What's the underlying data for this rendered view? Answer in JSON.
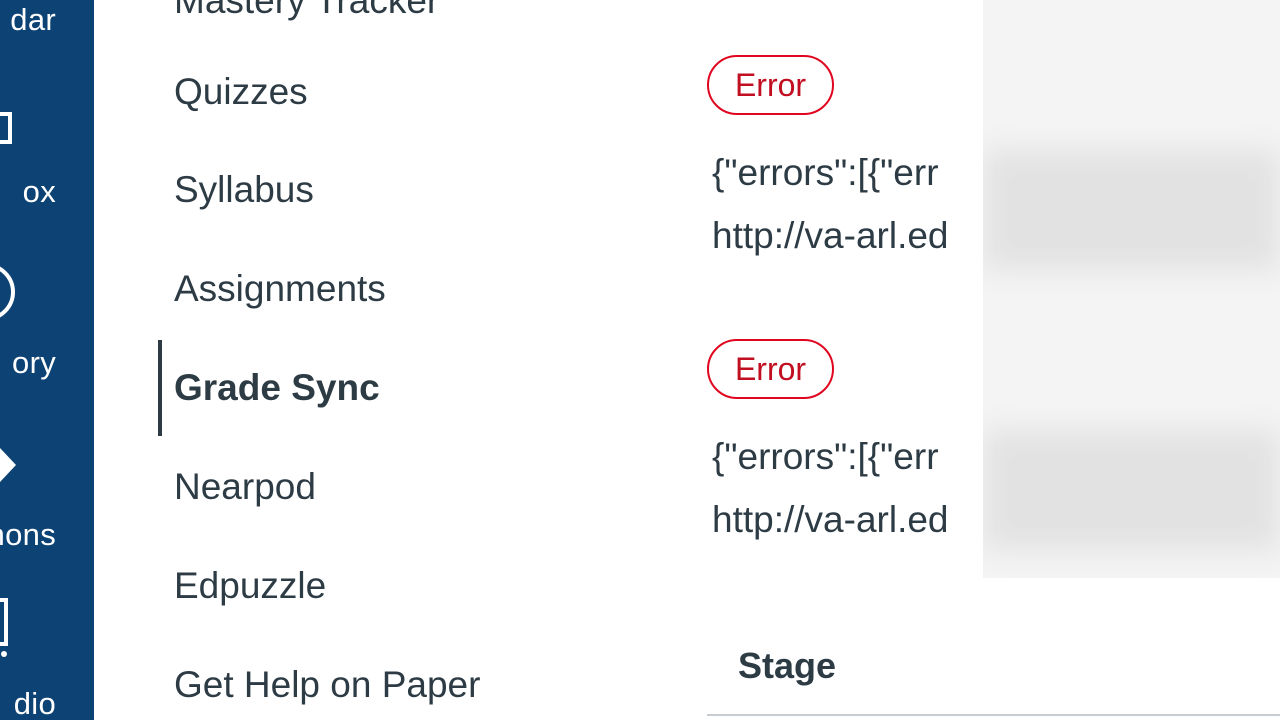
{
  "global_nav": {
    "items": [
      {
        "label": "dar",
        "icon": "calendar-icon"
      },
      {
        "label": "ox",
        "icon": "inbox-icon"
      },
      {
        "label": "ory",
        "icon": "history-icon"
      },
      {
        "label": "mons",
        "icon": "commons-icon"
      },
      {
        "label": "dio",
        "icon": "studio-icon"
      }
    ]
  },
  "course_nav": {
    "items": [
      {
        "label": "Mastery Tracker"
      },
      {
        "label": "Quizzes"
      },
      {
        "label": "Syllabus"
      },
      {
        "label": "Assignments"
      },
      {
        "label": "Grade Sync",
        "active": true
      },
      {
        "label": "Nearpod"
      },
      {
        "label": "Edpuzzle"
      },
      {
        "label": "Get Help on Paper"
      }
    ]
  },
  "main": {
    "errors": [
      {
        "status": "Error",
        "line1": "{\"errors\":[{\"err",
        "line2": "http://va-arl.ed"
      },
      {
        "status": "Error",
        "line1": "{\"errors\":[{\"err",
        "line2": "http://va-arl.ed"
      }
    ],
    "table": {
      "header": "Stage"
    }
  },
  "colors": {
    "global_nav_bg": "#0d4274",
    "error_red": "#e0061f",
    "text": "#2d3b45"
  }
}
